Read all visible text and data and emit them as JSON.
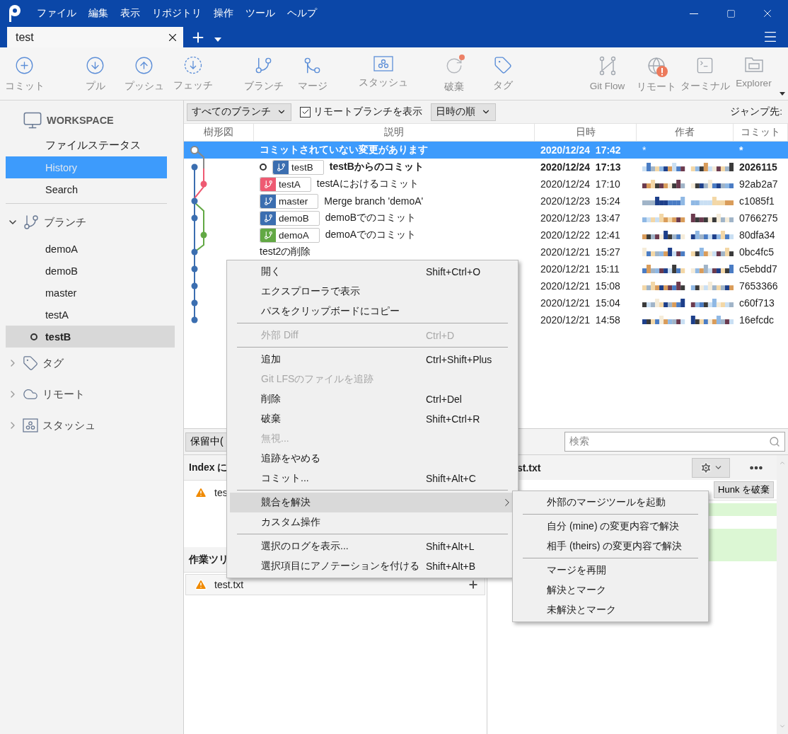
{
  "window": {
    "menu": [
      "ファイル",
      "編集",
      "表示",
      "リポジトリ",
      "操作",
      "ツール",
      "ヘルプ"
    ]
  },
  "tabs": [
    {
      "label": "test",
      "selected": true
    }
  ],
  "toolbar": {
    "groups": [
      [
        {
          "label": "コミット"
        }
      ],
      [
        {
          "label": "プル"
        },
        {
          "label": "プッシュ"
        },
        {
          "label": "フェッチ"
        }
      ],
      [
        {
          "label": "ブランチ"
        },
        {
          "label": "マージ"
        }
      ],
      [
        {
          "label": "スタッシュ"
        }
      ],
      [
        {
          "label": "破棄"
        },
        {
          "label": "タグ"
        }
      ]
    ],
    "right": [
      {
        "label": "Git Flow"
      },
      {
        "label": "リモート"
      },
      {
        "label": "ターミナル"
      },
      {
        "label": "Explorer"
      }
    ]
  },
  "sidebar": {
    "workspace": {
      "title": "WORKSPACE",
      "items": [
        {
          "label": "ファイルステータス",
          "selected": false
        },
        {
          "label": "History",
          "selected": true
        },
        {
          "label": "Search",
          "selected": false
        }
      ]
    },
    "sections": [
      {
        "title": "ブランチ",
        "expanded": true,
        "items": [
          {
            "label": "demoA",
            "selected": false,
            "current": false
          },
          {
            "label": "demoB",
            "selected": false,
            "current": false
          },
          {
            "label": "master",
            "selected": false,
            "current": false
          },
          {
            "label": "testA",
            "selected": false,
            "current": false
          },
          {
            "label": "testB",
            "selected": true,
            "current": true
          }
        ]
      },
      {
        "title": "タグ",
        "expanded": false
      },
      {
        "title": "リモート",
        "expanded": false
      },
      {
        "title": "スタッシュ",
        "expanded": false
      }
    ]
  },
  "filter_bar": {
    "branch_filter": "すべてのブランチ",
    "show_remote": {
      "label": "リモートブランチを表示",
      "checked": true
    },
    "sort": "日時の順",
    "jump_label": "ジャンプ先:"
  },
  "history": {
    "columns": [
      "樹形図",
      "説明",
      "日時",
      "作者",
      "コミット"
    ],
    "rows": [
      {
        "description": "コミットされていない変更があります",
        "date": "2020/12/24  17:42",
        "author": "*",
        "commit": "*",
        "selected": true,
        "bold": true,
        "head": false,
        "refs": []
      },
      {
        "description": "testBからのコミット",
        "date": "2020/12/24  17:13",
        "commit": "2026115",
        "selected": false,
        "bold": true,
        "head": true,
        "refs": [
          {
            "name": "testB",
            "color": "#3b6eb0"
          }
        ]
      },
      {
        "description": "testAにおけるコミット",
        "date": "2020/12/24  17:10",
        "commit": "92ab2a7",
        "selected": false,
        "bold": false,
        "head": false,
        "refs": [
          {
            "name": "testA",
            "color": "#ee5a72"
          }
        ]
      },
      {
        "description": "Merge branch 'demoA'",
        "date": "2020/12/23  15:24",
        "commit": "c1085f1",
        "selected": false,
        "bold": false,
        "head": false,
        "refs": [
          {
            "name": "master",
            "color": "#3b6eb0"
          }
        ]
      },
      {
        "description": "demoBでのコミット",
        "date": "2020/12/23  13:47",
        "commit": "0766275",
        "selected": false,
        "bold": false,
        "head": false,
        "refs": [
          {
            "name": "demoB",
            "color": "#3b6eb0"
          }
        ]
      },
      {
        "description": "demoAでのコミット",
        "date": "2020/12/22  12:41",
        "commit": "80dfa34",
        "selected": false,
        "bold": false,
        "head": false,
        "refs": [
          {
            "name": "demoA",
            "color": "#62a844"
          }
        ]
      },
      {
        "description": "test2の削除",
        "date": "2020/12/21  15:27",
        "commit": "0bc4fc5",
        "selected": false,
        "bold": false,
        "head": false,
        "refs": []
      },
      {
        "date": "2020/12/21  15:11",
        "commit": "c5ebdd7",
        "selected": false,
        "bold": false,
        "refs": []
      },
      {
        "date": "2020/12/21  15:08",
        "commit": "7653366",
        "selected": false,
        "bold": false,
        "refs": []
      },
      {
        "date": "2020/12/21  15:04",
        "commit": "c60f713",
        "selected": false,
        "bold": false,
        "refs": []
      },
      {
        "date": "2020/12/21  14:58",
        "commit": "16efcdc",
        "selected": false,
        "bold": false,
        "refs": []
      }
    ]
  },
  "bottom": {
    "stage_button": "保留中(",
    "search_placeholder": "検索",
    "index_header": "Index に",
    "index_files": [
      "tes"
    ],
    "worktree_header": "作業ツリ",
    "worktree_files": [
      "test.txt"
    ],
    "diff_title": "st.txt",
    "hunk_button": "Hunk を破棄"
  },
  "context_menu": {
    "items": [
      {
        "kind": "item",
        "label": "開く",
        "shortcut": "Shift+Ctrl+O",
        "disabled": false,
        "highlighted": false,
        "submenu": false
      },
      {
        "kind": "item",
        "label": "エクスプローラで表示",
        "disabled": false,
        "highlighted": false,
        "submenu": false
      },
      {
        "kind": "item",
        "label": "パスをクリップボードにコピー",
        "disabled": false,
        "highlighted": false,
        "submenu": false
      },
      {
        "kind": "separator"
      },
      {
        "kind": "item",
        "label": "外部 Diff",
        "shortcut": "Ctrl+D",
        "disabled": true,
        "highlighted": false,
        "submenu": false
      },
      {
        "kind": "separator"
      },
      {
        "kind": "item",
        "label": "追加",
        "shortcut": "Ctrl+Shift+Plus",
        "disabled": false,
        "highlighted": false,
        "submenu": false
      },
      {
        "kind": "item",
        "label": "Git LFSのファイルを追跡",
        "disabled": true,
        "highlighted": false,
        "submenu": false
      },
      {
        "kind": "item",
        "label": "削除",
        "shortcut": "Ctrl+Del",
        "disabled": false,
        "highlighted": false,
        "submenu": false
      },
      {
        "kind": "item",
        "label": "破棄",
        "shortcut": "Shift+Ctrl+R",
        "disabled": false,
        "highlighted": false,
        "submenu": false
      },
      {
        "kind": "item",
        "label": "無視...",
        "disabled": true,
        "highlighted": false,
        "submenu": false
      },
      {
        "kind": "item",
        "label": "追跡をやめる",
        "disabled": false,
        "highlighted": false,
        "submenu": false
      },
      {
        "kind": "item",
        "label": "コミット...",
        "shortcut": "Shift+Alt+C",
        "disabled": false,
        "highlighted": false,
        "submenu": false
      },
      {
        "kind": "separator"
      },
      {
        "kind": "item",
        "label": "競合を解決",
        "disabled": false,
        "highlighted": true,
        "submenu": true
      },
      {
        "kind": "item",
        "label": "カスタム操作",
        "disabled": false,
        "highlighted": false,
        "submenu": false
      },
      {
        "kind": "separator"
      },
      {
        "kind": "item",
        "label": "選択のログを表示...",
        "shortcut": "Shift+Alt+L",
        "disabled": false,
        "highlighted": false,
        "submenu": false
      },
      {
        "kind": "item",
        "label": "選択項目にアノテーションを付ける",
        "shortcut": "Shift+Alt+B",
        "disabled": false,
        "highlighted": false,
        "submenu": false
      }
    ]
  },
  "submenu": {
    "items": [
      {
        "kind": "item",
        "label": "外部のマージツールを起動"
      },
      {
        "kind": "separator"
      },
      {
        "kind": "item",
        "label": "自分 (mine) の変更内容で解決"
      },
      {
        "kind": "item",
        "label": "相手 (theirs) の変更内容で解決"
      },
      {
        "kind": "separator"
      },
      {
        "kind": "item",
        "label": "マージを再開"
      },
      {
        "kind": "item",
        "label": "解決とマーク"
      },
      {
        "kind": "item",
        "label": "未解決とマーク"
      }
    ]
  }
}
